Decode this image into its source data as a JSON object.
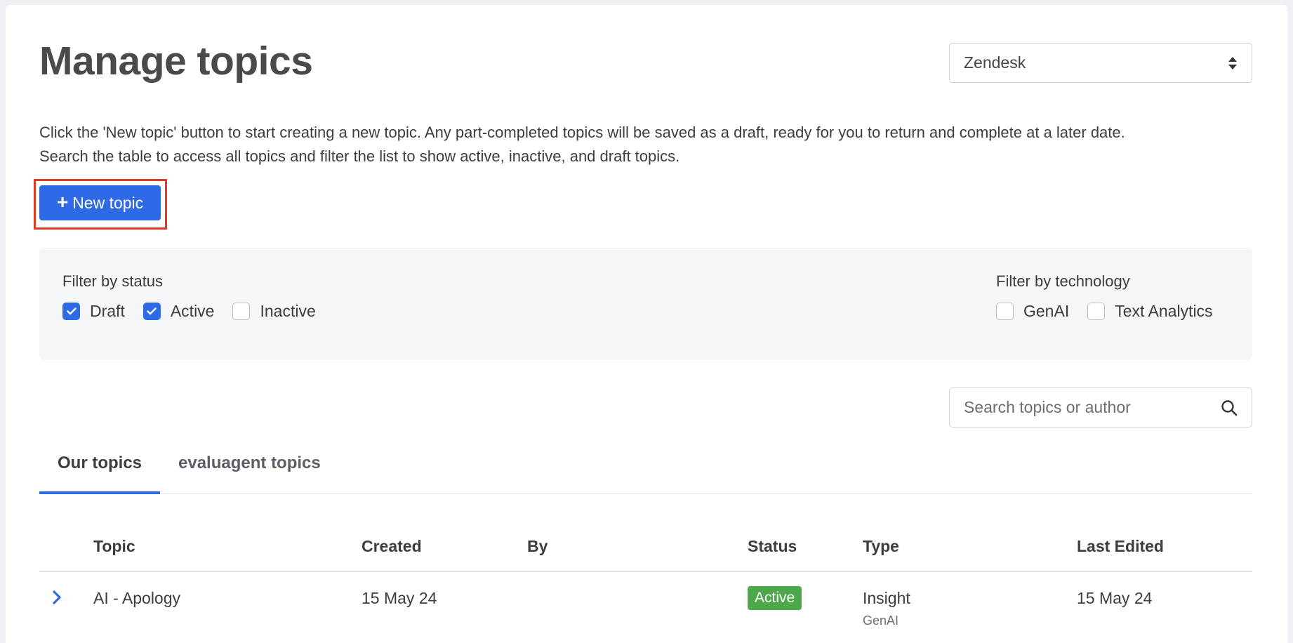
{
  "page": {
    "title": "Manage topics"
  },
  "platform_select": {
    "value": "Zendesk"
  },
  "intro": {
    "line1": "Click the 'New topic' button to start creating a new topic. Any part-completed topics will be saved as a draft, ready for you to return and complete at a later date.",
    "line2": "Search the table to access all topics and filter the list to show active, inactive, and draft topics."
  },
  "new_topic_button": {
    "icon": "+",
    "label": "New topic"
  },
  "filters": {
    "status": {
      "label": "Filter by status",
      "options": [
        {
          "label": "Draft",
          "checked": true
        },
        {
          "label": "Active",
          "checked": true
        },
        {
          "label": "Inactive",
          "checked": false
        }
      ]
    },
    "technology": {
      "label": "Filter by technology",
      "options": [
        {
          "label": "GenAI",
          "checked": false
        },
        {
          "label": "Text Analytics",
          "checked": false
        }
      ]
    }
  },
  "search": {
    "placeholder": "Search topics or author",
    "value": ""
  },
  "tabs": [
    {
      "label": "Our topics",
      "active": true
    },
    {
      "label": "evaluagent topics",
      "active": false
    }
  ],
  "table": {
    "columns": [
      "Topic",
      "Created",
      "By",
      "Status",
      "Type",
      "Last Edited"
    ],
    "rows": [
      {
        "topic": "AI - Apology",
        "created": "15 May 24",
        "by": "",
        "status": "Active",
        "type": "Insight",
        "type_sub": "GenAI",
        "last_edited": "15 May 24"
      }
    ]
  },
  "colors": {
    "accent": "#2f6ae6",
    "status_active": "#4ca84a",
    "highlight": "#e03a22"
  },
  "icons": {
    "select": "sort-icon",
    "search": "search-icon",
    "expand": "chevron-right-icon",
    "check": "check-icon"
  }
}
